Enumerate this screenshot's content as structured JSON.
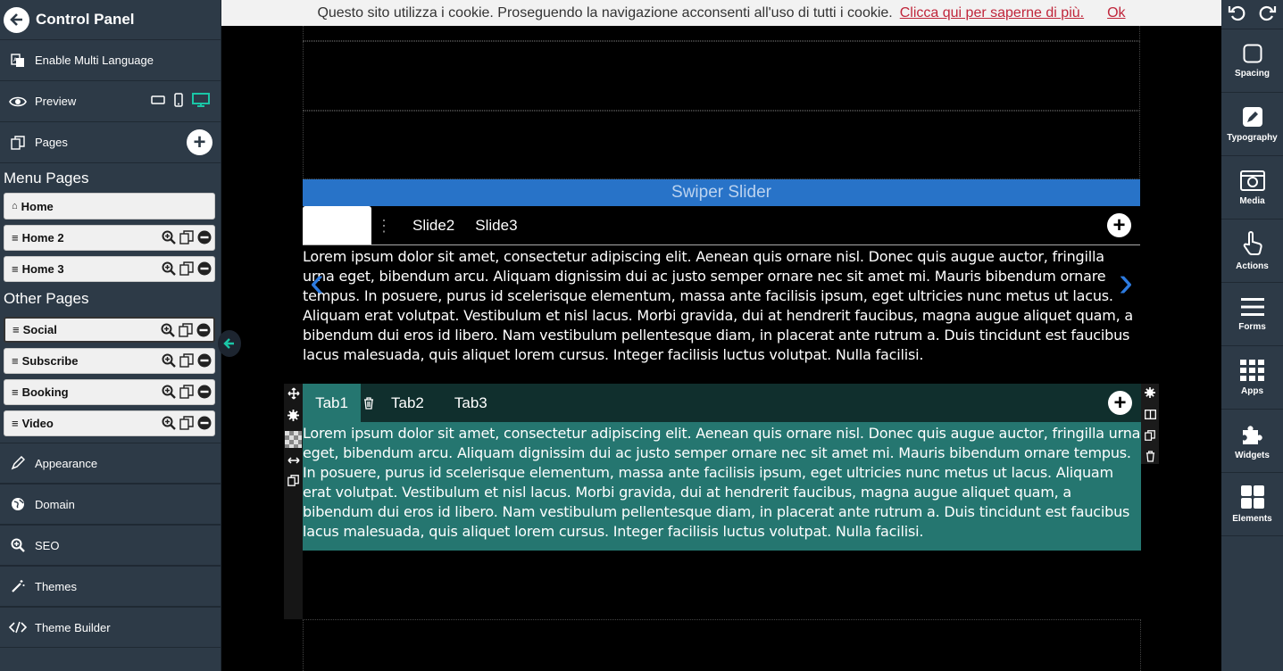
{
  "sidebar": {
    "title": "Control Panel",
    "multi_language": "Enable Multi Language",
    "preview": "Preview",
    "pages": "Pages",
    "menu_pages_heading": "Menu Pages",
    "other_pages_heading": "Other Pages",
    "menu_pages": [
      {
        "label": "Home",
        "icon": "house-icon"
      },
      {
        "label": "Home 2",
        "icon": "bars-icon"
      },
      {
        "label": "Home 3",
        "icon": "bars-icon"
      }
    ],
    "other_pages": [
      {
        "label": "Social"
      },
      {
        "label": "Subscribe"
      },
      {
        "label": "Booking"
      },
      {
        "label": "Video"
      }
    ],
    "bottom_menu": [
      {
        "label": "Appearance",
        "icon": "pencil-icon"
      },
      {
        "label": "Domain",
        "icon": "globe-icon"
      },
      {
        "label": "SEO",
        "icon": "magnifier-icon"
      },
      {
        "label": "Themes",
        "icon": "wand-icon"
      },
      {
        "label": "Theme Builder",
        "icon": "code-icon"
      }
    ]
  },
  "cookie": {
    "text": "Questo sito utilizza i cookie. Proseguendo la navigazione acconsenti all'uso di tutti i cookie.",
    "link": "Clicca qui per saperne di più.",
    "ok": "Ok"
  },
  "slider": {
    "title": "Swiper Slider",
    "tabs": [
      "Slide2",
      "Slide3"
    ],
    "body": "Lorem ipsum dolor sit amet, consectetur adipiscing elit. Aenean quis ornare nisl. Donec quis augue auctor, fringilla urna eget, bibendum arcu. Aliquam dignissim dui ac justo semper ornare nec sit amet mi. Mauris bibendum ornare tempus. In posuere, purus id scelerisque elementum, massa ante facilisis ipsum, eget ultricies nunc metus ut lacus. Aliquam erat volutpat. Vestibulum et nisl lacus. Morbi gravida, dui at hendrerit faucibus, magna augue aliquet quam, a bibendum dui eros id libero. Nam vestibulum pellentesque diam, in placerat ante rutrum a. Duis tincidunt est faucibus lacus malesuada, quis aliquet lorem cursus. Integer facilisis luctus volutpat. Nulla facilisi."
  },
  "tabs": {
    "active": "Tab1",
    "others": [
      "Tab2",
      "Tab3"
    ],
    "body": "Lorem ipsum dolor sit amet, consectetur adipiscing elit. Aenean quis ornare nisl. Donec quis augue auctor, fringilla urna eget, bibendum arcu. Aliquam dignissim dui ac justo semper ornare nec sit amet mi. Mauris bibendum ornare tempus. In posuere, purus id scelerisque elementum, massa ante facilisis ipsum, eget ultricies nunc metus ut lacus. Aliquam erat volutpat. Vestibulum et nisl lacus. Morbi gravida, dui at hendrerit faucibus, magna augue aliquet quam, a bibendum dui eros id libero. Nam vestibulum pellentesque diam, in placerat ante rutrum a. Duis tincidunt est faucibus lacus malesuada, quis aliquet lorem cursus. Integer facilisis luctus volutpat. Nulla facilisi."
  },
  "rightbar": {
    "items": [
      {
        "label": "Spacing",
        "icon": "square-icon"
      },
      {
        "label": "Typography",
        "icon": "pen-icon"
      },
      {
        "label": "Media",
        "icon": "camera-icon"
      },
      {
        "label": "Actions",
        "icon": "hand-pointer-icon"
      },
      {
        "label": "Forms",
        "icon": "lines-icon"
      },
      {
        "label": "Apps",
        "icon": "grid-icon"
      },
      {
        "label": "Widgets",
        "icon": "puzzle-icon"
      },
      {
        "label": "Elements",
        "icon": "blocks-icon"
      }
    ]
  },
  "colors": {
    "sidebar_bg": "#2d3a47",
    "slider_title_bg": "#2873c8",
    "tabs_bg": "#257670",
    "accent_teal": "#1ac6a6",
    "cookie_link": "#c0263b"
  }
}
